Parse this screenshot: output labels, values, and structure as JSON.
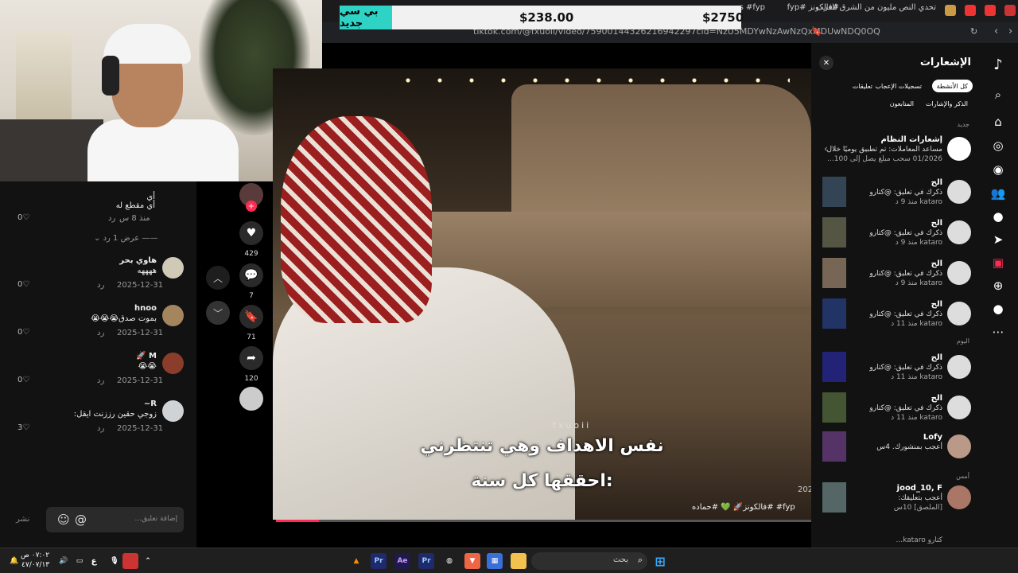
{
  "tabs": [
    {
      "label": "#فالكونز #fyp"
    },
    {
      "label": "ms #fyp"
    },
    {
      "label": "تحدي النص مليون من الشرق للغرب بالك"
    }
  ],
  "url": "tiktok.com/@fxuoii/video/75900144326216942297cid=NzU5MDYwNzAwNzQxMDUwNDQ0OQ",
  "overlay": {
    "badge": "بي سي جديد",
    "price_mid": "$238.00",
    "price_right": "$2750"
  },
  "comments": {
    "top_text": "أي",
    "top_reply": "أي مقطع له",
    "top_time": "منذ 8 س",
    "reply_label": "رد",
    "view_replies": "عرض 1 رد",
    "items": [
      {
        "name": "هاوي بحر",
        "text": "ههههه",
        "date": "2025-12-31",
        "likes": "0"
      },
      {
        "name": "hnoo",
        "text": "بموت صدق😭😭😭",
        "date": "2025-12-31",
        "likes": "0"
      },
      {
        "name": "M 🚀",
        "text": "😭😭",
        "date": "2025-12-31",
        "likes": "0"
      },
      {
        "name": "R~",
        "text": "زوجي حقين رززنت ايقل:",
        "date": "2025-12-31",
        "likes": "3"
      }
    ],
    "first_likes": "0",
    "input_placeholder": "إضافة تعليق...",
    "post_label": "نشر"
  },
  "actions": {
    "likes": "429",
    "comments": "7",
    "saves": "71",
    "shares": "120"
  },
  "video": {
    "watermark": "fxuoii",
    "subtitle1": "نفس الاهداف وهي تنتظرني",
    "subtitle2": "احققها كل سنة:",
    "year": "202",
    "caption": "fyp# #فالكونز🚀 💚 #حماده",
    "progress_fraction": 0.08
  },
  "notifications": {
    "title": "الإشعارات",
    "filters": [
      "كل الأنشطة",
      "تسجيلات الإعجاب",
      "تعليقات",
      "الذكر والإشارات",
      "المتابعون"
    ],
    "new_label": "جديد",
    "today_label": "اليوم",
    "yesterday_label": "أمس",
    "system": {
      "name": "إشعارات النظام",
      "text": "مساعد المعاملات: تم تطبيق يوميًا خلال",
      "text2": "01/2026 سحب مبلغ يصل إلى 100..."
    },
    "items": [
      {
        "name": "الح",
        "text": "ذكرك في تعليق: @كتارو",
        "time": "kataro منذ 9 د"
      },
      {
        "name": "الح",
        "text": "ذكرك في تعليق: @كتارو",
        "time": "kataro منذ 9 د"
      },
      {
        "name": "الح",
        "text": "ذكرك في تعليق: @كتارو",
        "time": "kataro منذ 9 د"
      },
      {
        "name": "الح",
        "text": "ذكرك في تعليق: @كتارو",
        "time": "kataro منذ 11 د"
      },
      {
        "name": "الح",
        "text": "ذكرك في تعليق: @كتارو",
        "time": "kataro منذ 11 د"
      },
      {
        "name": "الح",
        "text": "ذكرك في تعليق: @كتارو",
        "time": "kataro منذ 11 د"
      },
      {
        "name": "Lofy",
        "text": "أعجب بمنشورك. 4س",
        "time": ""
      },
      {
        "name": "jood_10, F",
        "text": "أعجب بتعليقك:",
        "time": "[الملصق] 10س"
      }
    ],
    "last_line": "كتارو kataro..."
  },
  "taskbar": {
    "search_placeholder": "بحث",
    "time": "٠٧:٠٢ ص",
    "date": "٤٧/٠٧/١٣"
  },
  "colors": {
    "accent": "#fe2c55",
    "badge": "#2fd3c6"
  }
}
